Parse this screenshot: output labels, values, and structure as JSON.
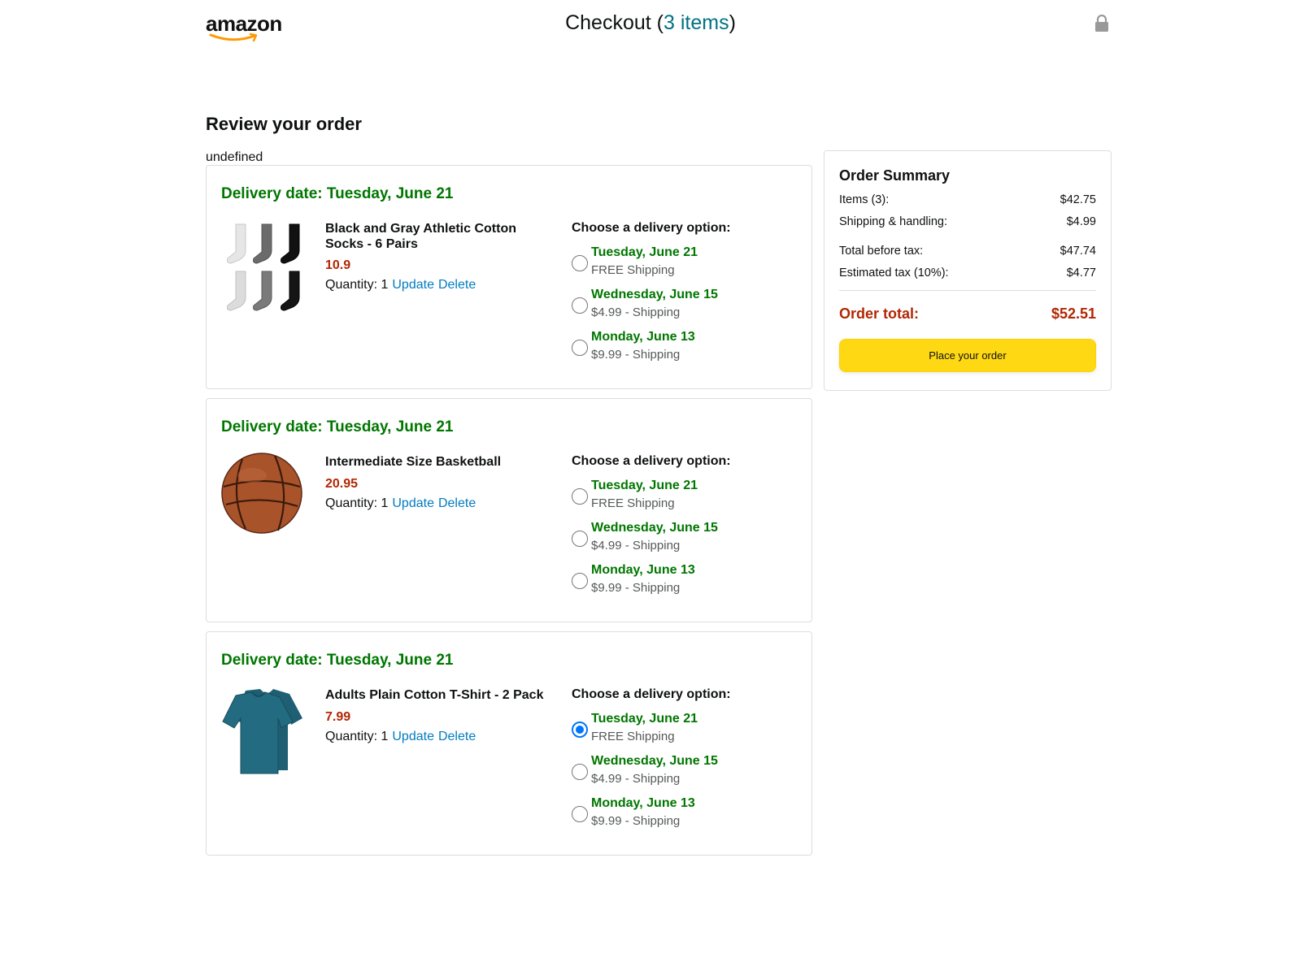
{
  "header": {
    "logo_text": "amazon",
    "title_prefix": "Checkout (",
    "title_count": "3 items",
    "title_suffix": ")"
  },
  "page": {
    "title": "Review your order",
    "stray_text": "undefined"
  },
  "orders": [
    {
      "delivery_date": "Delivery date: Tuesday, June 21",
      "product_name": "Black and Gray Athletic Cotton Socks - 6 Pairs",
      "price": "10.9",
      "quantity": "Quantity: 1",
      "update_label": "Update",
      "delete_label": "Delete",
      "options_title": "Choose a delivery option:",
      "options": [
        {
          "date": "Tuesday, June 21",
          "cost": "FREE Shipping",
          "selected": false
        },
        {
          "date": "Wednesday, June 15",
          "cost": "$4.99 - Shipping",
          "selected": false
        },
        {
          "date": "Monday, June 13",
          "cost": "$9.99 - Shipping",
          "selected": false
        }
      ]
    },
    {
      "delivery_date": "Delivery date: Tuesday, June 21",
      "product_name": "Intermediate Size Basketball",
      "price": "20.95",
      "quantity": "Quantity: 1",
      "update_label": "Update",
      "delete_label": "Delete",
      "options_title": "Choose a delivery option:",
      "options": [
        {
          "date": "Tuesday, June 21",
          "cost": "FREE Shipping",
          "selected": false
        },
        {
          "date": "Wednesday, June 15",
          "cost": "$4.99 - Shipping",
          "selected": false
        },
        {
          "date": "Monday, June 13",
          "cost": "$9.99 - Shipping",
          "selected": false
        }
      ]
    },
    {
      "delivery_date": "Delivery date: Tuesday, June 21",
      "product_name": "Adults Plain Cotton T-Shirt - 2 Pack",
      "price": "7.99",
      "quantity": "Quantity: 1",
      "update_label": "Update",
      "delete_label": "Delete",
      "options_title": "Choose a delivery option:",
      "options": [
        {
          "date": "Tuesday, June 21",
          "cost": "FREE Shipping",
          "selected": true
        },
        {
          "date": "Wednesday, June 15",
          "cost": "$4.99 - Shipping",
          "selected": false
        },
        {
          "date": "Monday, June 13",
          "cost": "$9.99 - Shipping",
          "selected": false
        }
      ]
    }
  ],
  "summary": {
    "title": "Order Summary",
    "rows": [
      {
        "label": "Items (3):",
        "value": "$42.75"
      },
      {
        "label": "Shipping & handling:",
        "value": "$4.99"
      },
      {
        "label": "Total before tax:",
        "value": "$47.74"
      },
      {
        "label": "Estimated tax (10%):",
        "value": "$4.77"
      }
    ],
    "total_label": "Order total:",
    "total_value": "$52.51",
    "button_label": "Place your order"
  },
  "colors": {
    "delivery_green": "#007600",
    "price_red": "#b12704",
    "link_blue": "#017cc0",
    "button_yellow": "#ffd814"
  }
}
